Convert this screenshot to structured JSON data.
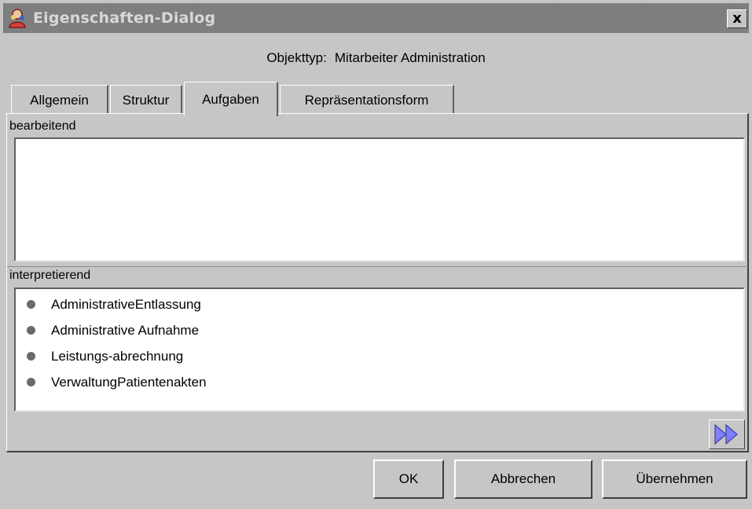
{
  "window": {
    "title": "Eigenschaften-Dialog",
    "close_label": "x"
  },
  "object_type": {
    "label": "Objekttyp:",
    "value": "Mitarbeiter Administration"
  },
  "tabs": [
    {
      "label": "Allgemein",
      "active": false
    },
    {
      "label": "Struktur",
      "active": false
    },
    {
      "label": "Aufgaben",
      "active": true
    },
    {
      "label": "Repräsentationsform",
      "active": false
    }
  ],
  "sections": {
    "bearbeitend": {
      "label": "bearbeitend",
      "items": []
    },
    "interpretierend": {
      "label": "interpretierend",
      "items": [
        "AdministrativeEntlassung",
        "Administrative Aufnahme",
        "Leistungs-abrechnung",
        "VerwaltungPatientenakten"
      ]
    }
  },
  "buttons": {
    "ok": "OK",
    "cancel": "Abbrechen",
    "apply": "Übernehmen"
  },
  "icons": {
    "app": "app-icon",
    "forward": "double-arrow-right-icon"
  },
  "colors": {
    "titlebar": "#7b7b7b",
    "background": "#c6c6c6",
    "forward_arrow": "#6a6aff"
  }
}
